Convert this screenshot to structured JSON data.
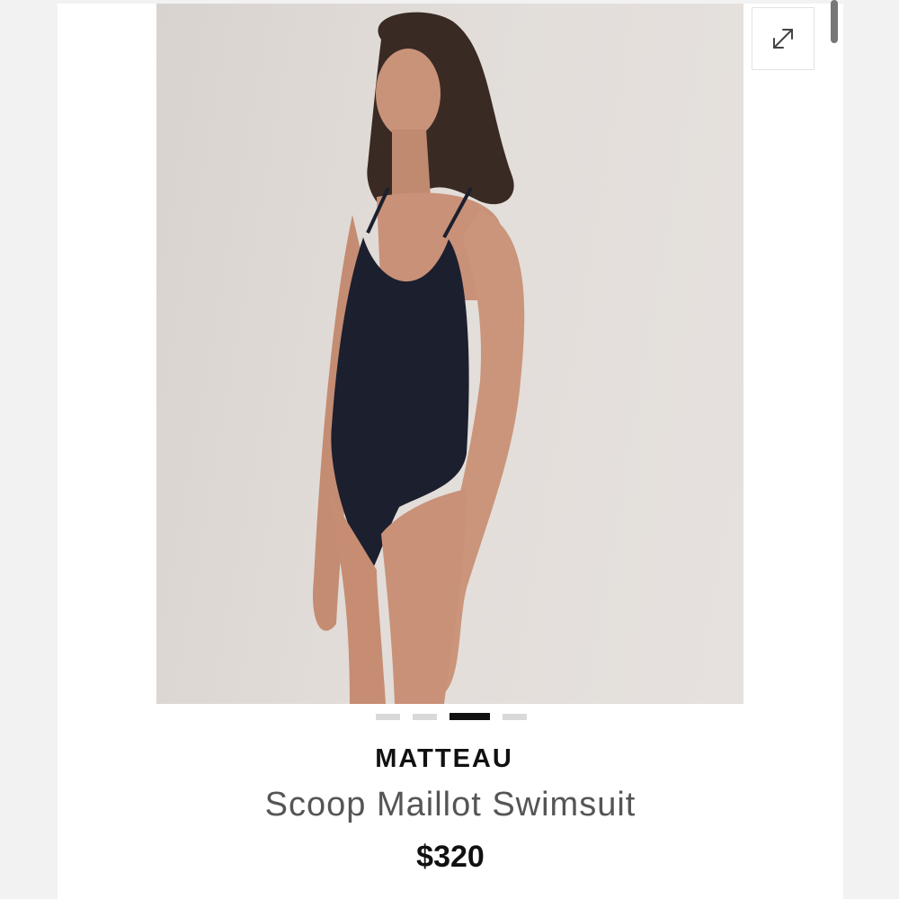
{
  "product": {
    "brand": "MATTEAU",
    "name": "Scoop Maillot Swimsuit",
    "price": "$320"
  },
  "gallery": {
    "image_count": 4,
    "active_index": 2,
    "expand_icon": "expand-diagonal-arrows-icon"
  },
  "colors": {
    "swimsuit": "#1c1f2e",
    "photo_background": "#e2ddd9",
    "active_dot": "#111111",
    "inactive_dot": "#d9d9d9"
  }
}
